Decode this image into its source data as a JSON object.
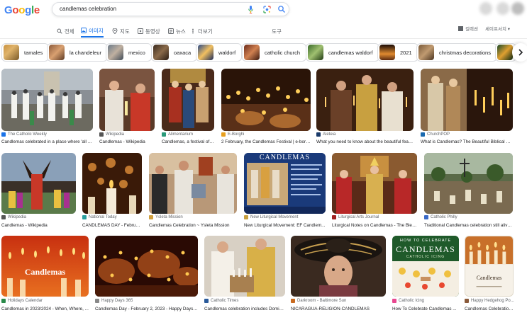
{
  "header": {
    "logo": "Google",
    "search_query": "candlemas celebration"
  },
  "tabs": [
    {
      "label": "전체",
      "icon": "search-icon"
    },
    {
      "label": "이미지",
      "icon": "image-icon",
      "active": true
    },
    {
      "label": "지도",
      "icon": "map-pin-icon"
    },
    {
      "label": "동영상",
      "icon": "video-icon"
    },
    {
      "label": "뉴스",
      "icon": "news-icon"
    },
    {
      "label": "더보기",
      "icon": "more-icon"
    }
  ],
  "tools_label": "도구",
  "right_links": {
    "saved": "컬렉션",
    "safe_search": "세이프서치 ▾"
  },
  "chips": [
    {
      "label": "tamales"
    },
    {
      "label": "la chandeleur"
    },
    {
      "label": "mexico"
    },
    {
      "label": "oaxaca"
    },
    {
      "label": "waldorf"
    },
    {
      "label": "catholic church"
    },
    {
      "label": "candlemas waldorf"
    },
    {
      "label": "2021"
    },
    {
      "label": "christmas decorations"
    }
  ],
  "results": {
    "row1": [
      {
        "source": "The Catholic Weekly",
        "title": "Candlemas celebrated in a place where 'all c..."
      },
      {
        "source": "Wikipedia",
        "title": "Candlemas - Wikipedia"
      },
      {
        "source": "Alimentarium",
        "title": "Candlemas, a festival of ..."
      },
      {
        "source": "E-Borghi",
        "title": "2 February, the Candlemas Festival | e-borghi"
      },
      {
        "source": "Aleteia",
        "title": "What you need to know about the beautiful feas..."
      },
      {
        "source": "ChurchPOP",
        "title": "What is Candlemas? The Beautiful Biblical Ce..."
      }
    ],
    "row2": [
      {
        "source": "Wikipedia",
        "title": "Candlemas - Wikipedia"
      },
      {
        "source": "National Today",
        "title": "CANDLEMAS DAY - February ..."
      },
      {
        "source": "Ysleta Mission",
        "title": "Candlemas Celebration ~ Ysleta Mission"
      },
      {
        "source": "New Liturgical Movement",
        "title": "New Liturgical Movement: EF Candlem...",
        "image_text": "CANDLEMAS"
      },
      {
        "source": "Liturgical Arts Journal",
        "title": "Liturgical Notes on Candlemas - The Bles..."
      },
      {
        "source": "Catholic Philly",
        "title": "Traditional Candlemas celebration still alive..."
      }
    ],
    "row3": [
      {
        "source": "Holidays Calendar",
        "title": "Candlemas in 2023/2024 - When, Where, ...",
        "image_text": "Candlemas"
      },
      {
        "source": "Happy Days 365",
        "title": "Candlemas Day - February 2, 2023 - Happy Days 365"
      },
      {
        "source": "Catholic Times",
        "title": "Candlemas celebration includes Domin..."
      },
      {
        "source": "Darkroom - Baltimore Sun",
        "title": "NICARAGUA-RELIGION-CANDLEMAS"
      },
      {
        "source": "Catholic Icing",
        "title": "How To Celebrate Candlemas ...",
        "image_text": "HOW TO CELEBRATE",
        "image_text_big": "CANDLEMAS",
        "image_text_small": "CATHOLIC ICING"
      },
      {
        "source": "Happy Hedgehog Po...",
        "title": "Candlemas Celebration...",
        "image_text": "Candlemas"
      }
    ]
  }
}
